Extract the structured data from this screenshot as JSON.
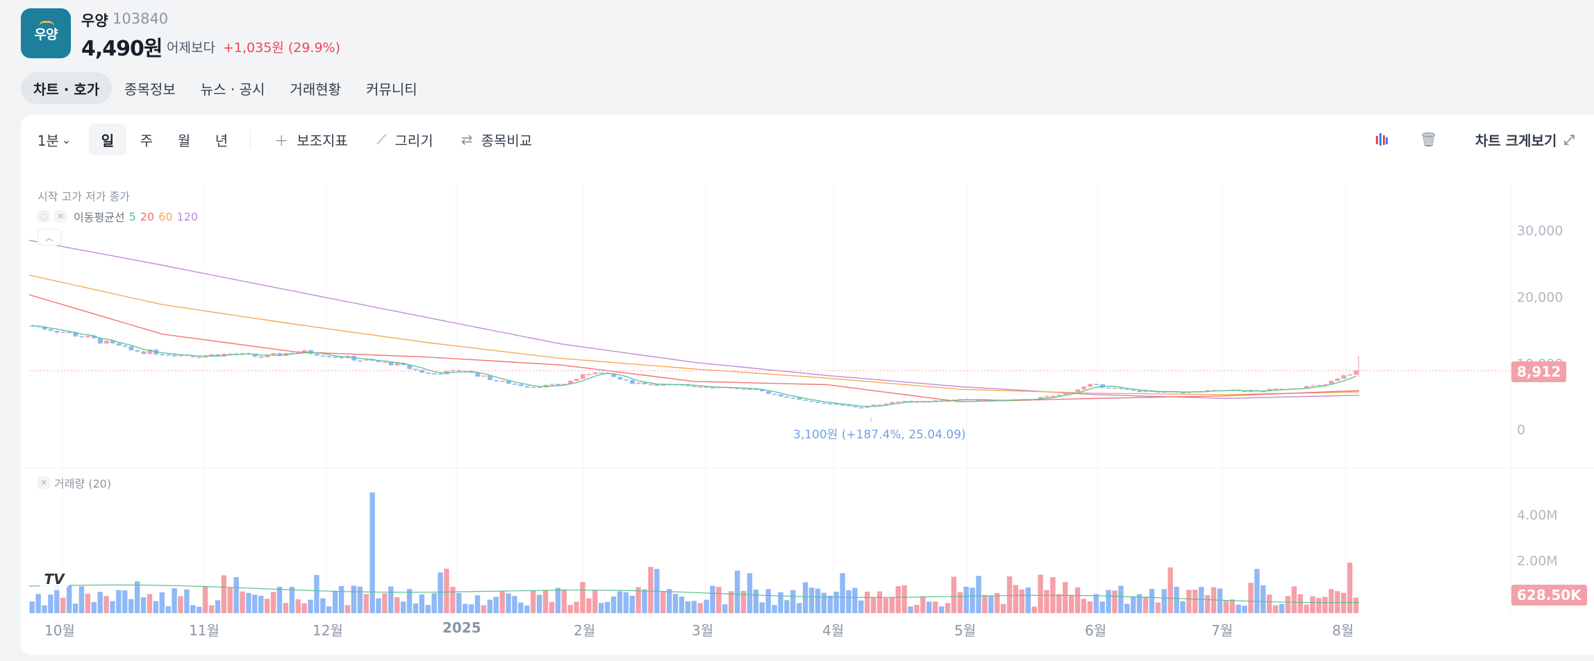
{
  "header": {
    "logo_text": "우양",
    "name": "우양",
    "code": "103840",
    "price": "4,490원",
    "vs_label": "어제보다",
    "change": "+1,035원 (29.9%)"
  },
  "tabs": [
    "차트 · 호가",
    "종목정보",
    "뉴스 · 공시",
    "거래현황",
    "커뮤니티"
  ],
  "toolbar": {
    "interval": "1분",
    "periods": [
      "일",
      "주",
      "월",
      "년"
    ],
    "indicator": "보조지표",
    "draw": "그리기",
    "compare": "종목비교",
    "expand": "차트 크게보기"
  },
  "legend": {
    "ohlc": "시작 고가 저가 종가",
    "ma_label": "이동평균선",
    "ma_periods": [
      {
        "value": "5",
        "color": "#5bbf8e"
      },
      {
        "value": "20",
        "color": "#f27373"
      },
      {
        "value": "60",
        "color": "#f5a953"
      },
      {
        "value": "120",
        "color": "#c08ad6"
      }
    ],
    "volume_label": "거래량 (20)"
  },
  "price_axis": [
    "30,000",
    "20,000",
    "10,000",
    "0"
  ],
  "price_tag": "8,912",
  "volume_axis": [
    "4.00M",
    "2.00M"
  ],
  "volume_tag": "628.50K",
  "annotation": "3,100원 (+187.4%, 25.04.09)",
  "months": [
    "10월",
    "11월",
    "12월",
    "2025",
    "2월",
    "3월",
    "4월",
    "5월",
    "6월",
    "7월",
    "8월"
  ],
  "colors": {
    "up": "#f4a0a8",
    "down": "#8fb8f5",
    "brand": "#1e7f9c",
    "negative": "#f04452"
  },
  "chart_data": {
    "type": "candlestick",
    "x_start": "2024-09-25",
    "x_end": "2025-08-01",
    "ylim": [
      0,
      35000
    ],
    "volume_ylim": [
      0,
      5000000
    ],
    "close_series": [
      15800,
      14800,
      13500,
      12000,
      11600,
      11200,
      11500,
      11000,
      11900,
      11300,
      10500,
      9900,
      8400,
      9000,
      7400,
      6500,
      6800,
      8900,
      7200,
      6800,
      6600,
      6400,
      5800,
      4700,
      3900,
      3300,
      4200,
      4300,
      4500,
      4400,
      4500,
      5200,
      6800,
      6000,
      5600,
      5700,
      5900,
      5800,
      6300,
      6700,
      8912
    ],
    "ma120_series": [
      28800,
      25000,
      21000,
      17000,
      13000,
      10200,
      8200,
      6500,
      5300,
      4700,
      5200
    ],
    "ma60_series": [
      23500,
      19000,
      16000,
      13200,
      10800,
      9200,
      7800,
      6100,
      5500,
      5300,
      5700
    ],
    "ma20_series": [
      20500,
      14500,
      11800,
      11000,
      9800,
      7300,
      6800,
      4200,
      4700,
      5100,
      5900
    ],
    "peak_volume": 4900000,
    "last_volume": 628500
  }
}
